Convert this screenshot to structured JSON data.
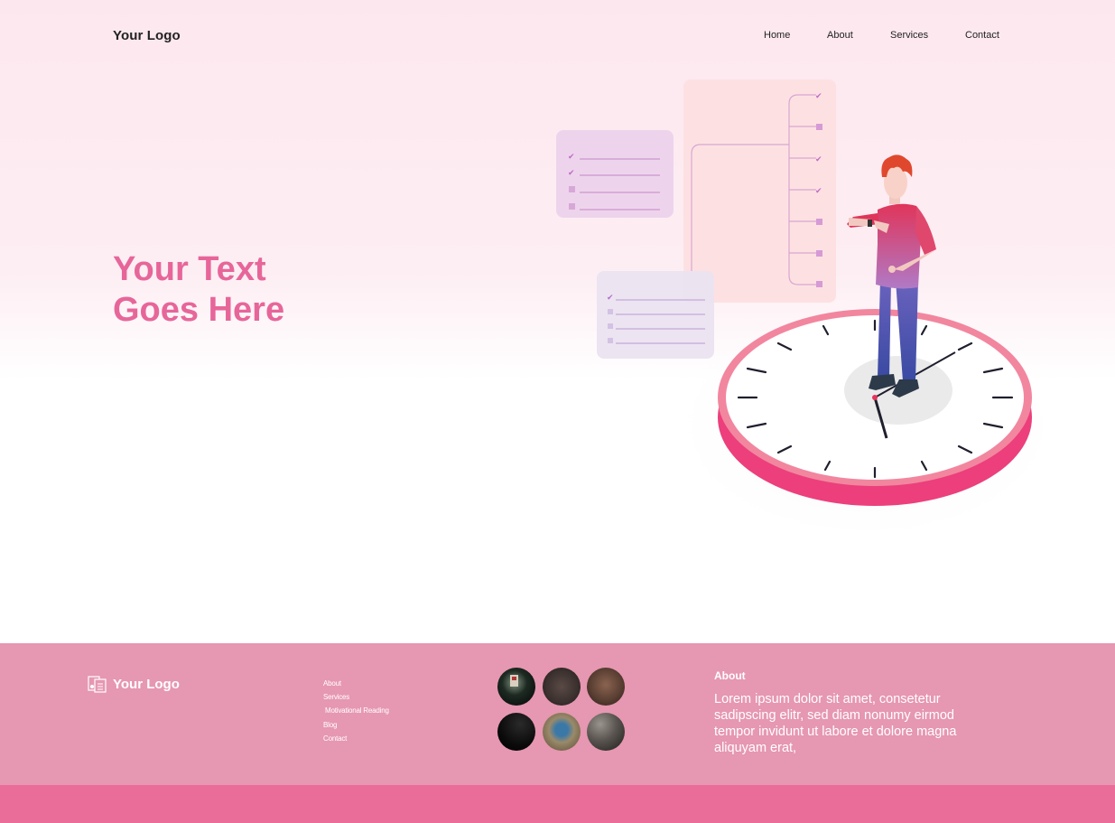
{
  "header": {
    "logo": "Your Logo",
    "nav": [
      {
        "label": "Home"
      },
      {
        "label": "About"
      },
      {
        "label": "Services"
      },
      {
        "label": "Contact"
      }
    ]
  },
  "hero": {
    "headline_line1": "Your Text",
    "headline_line2": "Goes Here"
  },
  "illustration": {
    "checklist_1_checked": 2,
    "checklist_1_items": 4,
    "checklist_2_checked": 1,
    "checklist_2_items": 4,
    "timeline_items": 7
  },
  "footer": {
    "logo": "Your Logo",
    "links": [
      "About",
      "Services",
      "Motivational Reading",
      "Blog",
      "Contact"
    ],
    "gallery_count": 6,
    "about_title": "About",
    "about_text": "Lorem ipsum dolor sit amet, consetetur sadipscing elitr, sed diam nonumy eirmod tempor invidunt ut labore et dolore magna aliquyam erat,"
  },
  "colors": {
    "accent": "#e7669a",
    "footer_bg": "#e697b1",
    "bottom_bar": "#ea6c98",
    "hero_bg": "#fde7ef"
  }
}
